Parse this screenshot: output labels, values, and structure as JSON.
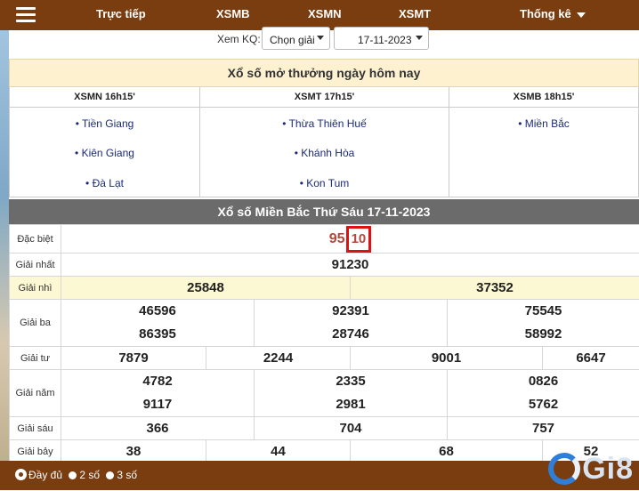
{
  "nav": {
    "items": [
      "Trực tiếp",
      "XSMB",
      "XSMN",
      "XSMT"
    ],
    "thongke": "Thống kê"
  },
  "filter": {
    "label": "Xem KQ:",
    "select_value": "Chọn giải",
    "date_value": "17-11-2023"
  },
  "today": {
    "title": "Xổ số mở thưởng ngày hôm nay",
    "columns": [
      {
        "header": "XSMN 16h15'",
        "stations": [
          "Tiền Giang",
          "Kiên Giang",
          "Đà Lạt"
        ]
      },
      {
        "header": "XSMT 17h15'",
        "stations": [
          "Thừa Thiên Huế",
          "Khánh Hòa",
          "Kon Tum"
        ]
      },
      {
        "header": "XSMB 18h15'",
        "stations": [
          "Miền Bắc"
        ]
      }
    ]
  },
  "results": {
    "title": "Xổ số Miền Bắc Thứ Sáu 17-11-2023",
    "labels": [
      "Đặc biệt",
      "Giải nhất",
      "Giải nhì",
      "Giải ba",
      "Giải tư",
      "Giải năm",
      "Giải sáu",
      "Giải bảy"
    ],
    "dac_biet_prefix": "95",
    "dac_biet_suffix": "10",
    "giai_nhat": "91230",
    "giai_nhi": [
      "25848",
      "37352"
    ],
    "giai_ba": [
      "46596",
      "92391",
      "75545",
      "86395",
      "28746",
      "58992"
    ],
    "giai_tu": [
      "7879",
      "2244",
      "9001",
      "6647"
    ],
    "giai_nam": [
      "4782",
      "2335",
      "0826",
      "9117",
      "2981",
      "5762"
    ],
    "giai_sau": [
      "366",
      "704",
      "757"
    ],
    "giai_bay": [
      "38",
      "44",
      "68",
      "52"
    ]
  },
  "footer": {
    "options": [
      "Đầy đủ",
      "2 số",
      "3 số"
    ],
    "selected": "Đầy đủ",
    "logo_text": "Gi8"
  }
}
